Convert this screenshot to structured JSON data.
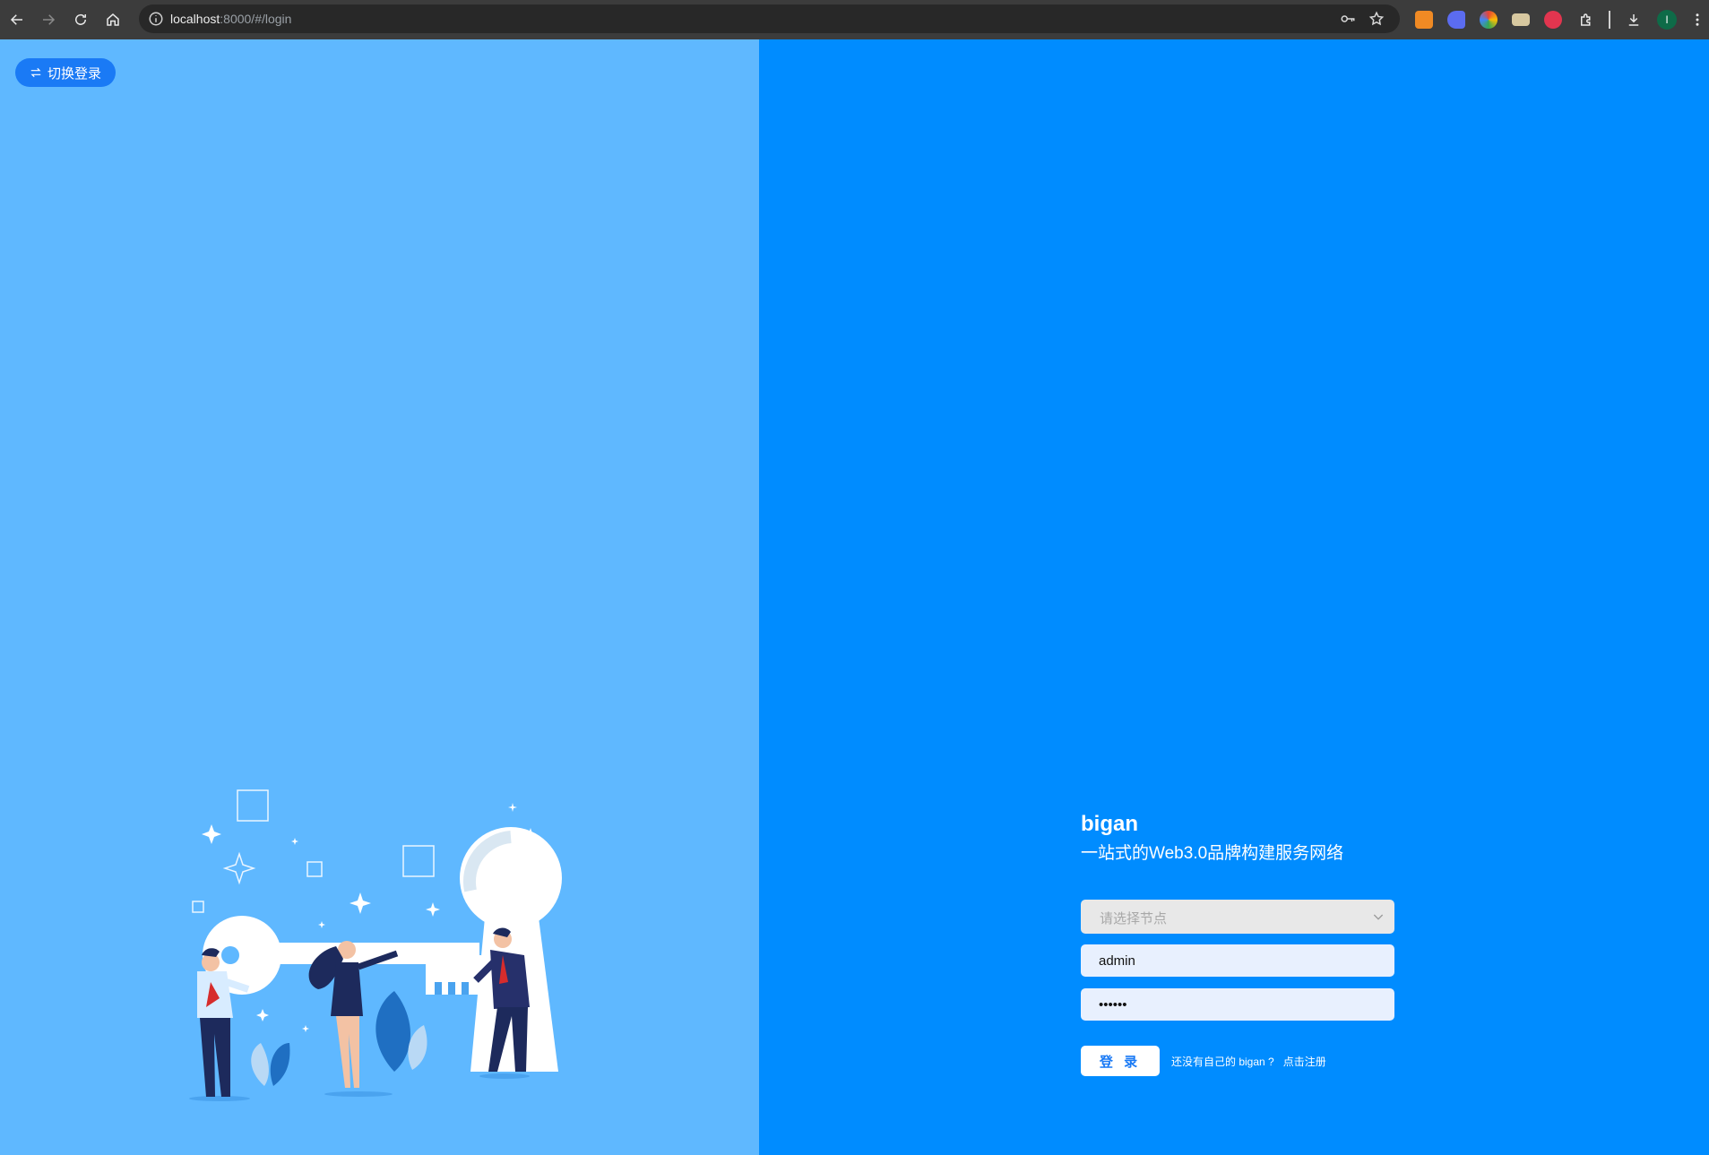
{
  "browser": {
    "url_host": "localhost",
    "url_rest": ":8000/#/login",
    "profile_initial": "I",
    "icons": [
      "back-icon",
      "forward-icon",
      "reload-icon",
      "home-icon",
      "site-info-icon",
      "password-key-icon",
      "bookmark-star-icon",
      "extensions-puzzle-icon",
      "download-icon",
      "menu-kebab-icon"
    ]
  },
  "page": {
    "switch_login_label": "切换登录",
    "brand": "bigan",
    "tagline": "一站式的Web3.0品牌构建服务网络",
    "node_select": {
      "placeholder": "请选择节点"
    },
    "username": {
      "value": "admin"
    },
    "password": {
      "value": "••••••"
    },
    "login_button": "登 录",
    "no_account_hint": "还没有自己的 bigan ?",
    "register_link": "点击注册"
  },
  "colors": {
    "left_bg": "#5fb8ff",
    "right_bg": "#008cff",
    "accent_button": "#1a7af5"
  }
}
